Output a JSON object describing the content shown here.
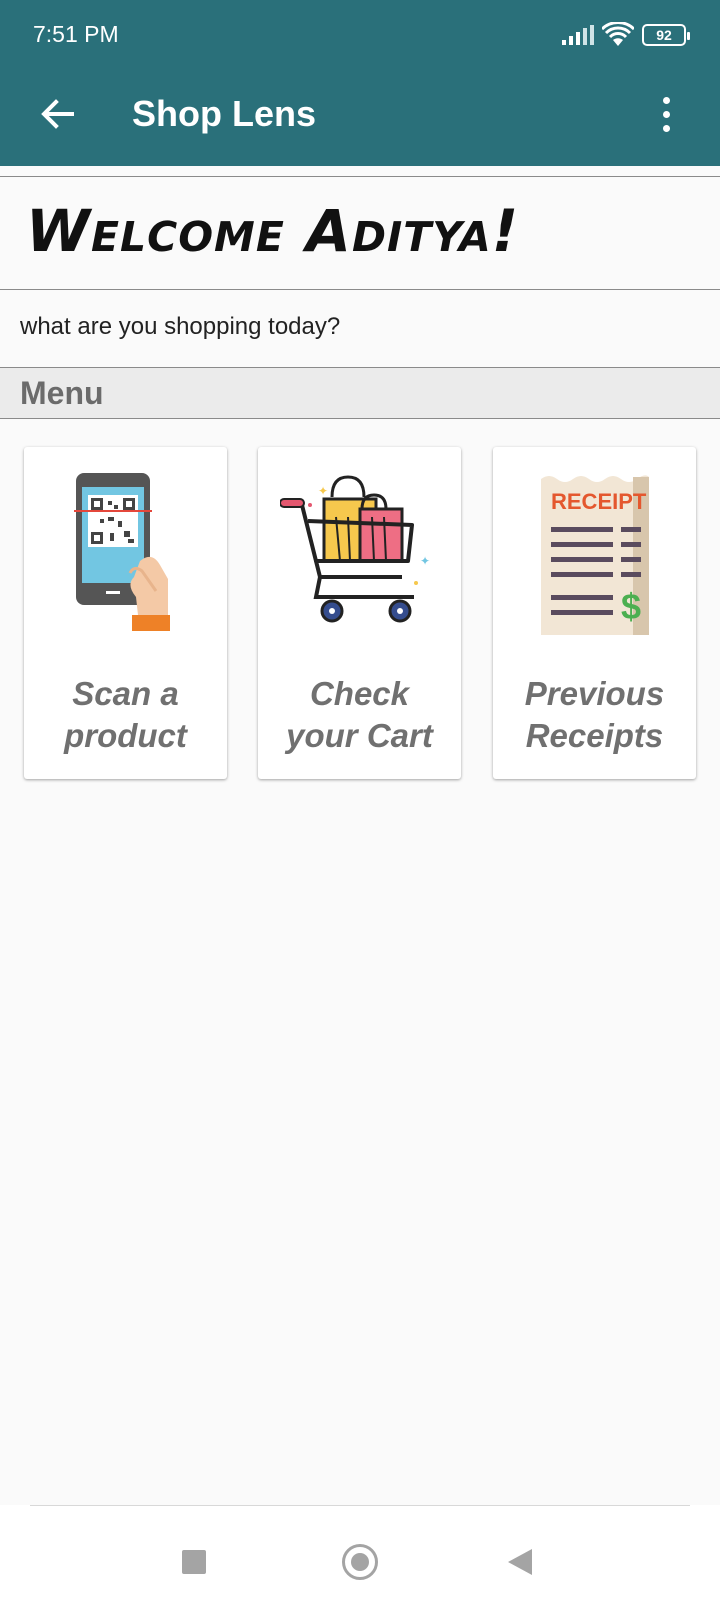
{
  "status_bar": {
    "time": "7:51 PM",
    "battery": "92"
  },
  "app_bar": {
    "title": "Shop Lens"
  },
  "welcome": {
    "heading": "Welcome Aditya!",
    "subtitle": "what are you shopping today?"
  },
  "menu": {
    "header": "Menu",
    "items": [
      {
        "label_line1": "Scan a",
        "label_line2": "product",
        "icon": "qr-scan-phone-icon"
      },
      {
        "label_line1": "Check",
        "label_line2": "your Cart",
        "icon": "shopping-cart-icon"
      },
      {
        "label_line1": "Previous",
        "label_line2": "Receipts",
        "icon": "receipt-icon"
      }
    ]
  },
  "receipt_icon_text": "RECEIPT",
  "receipt_icon_currency": "$",
  "colors": {
    "primary": "#2a707a",
    "card_label": "#707070",
    "menu_header_bg": "#ebebeb"
  }
}
